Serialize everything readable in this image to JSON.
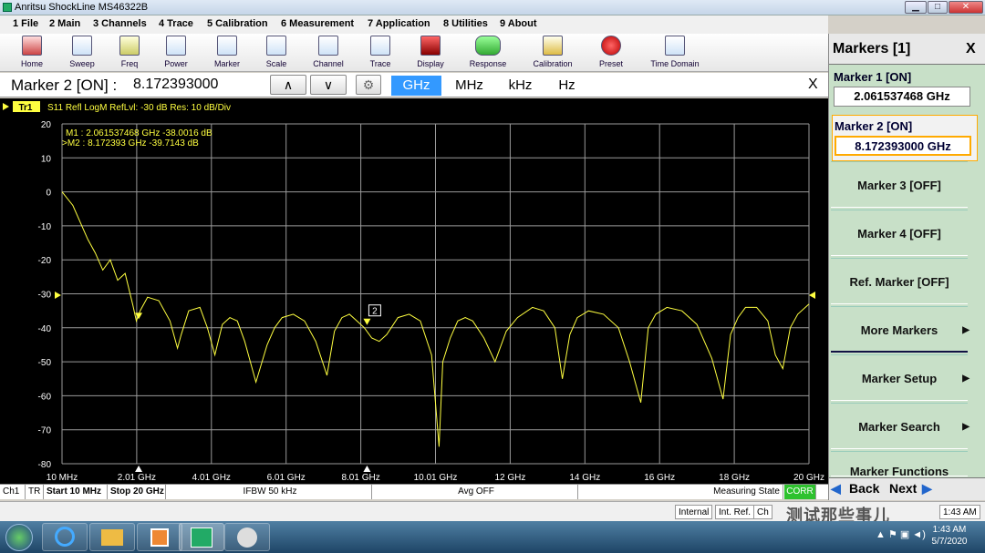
{
  "window": {
    "title": "Anritsu ShockLine MS46322B"
  },
  "menu": [
    "1 File",
    "2 Main",
    "3 Channels",
    "4 Trace",
    "5 Calibration",
    "6 Measurement",
    "7 Application",
    "8 Utilities",
    "9 About"
  ],
  "toolbar": [
    "Home",
    "Sweep",
    "Freq",
    "Power",
    "Marker",
    "Scale",
    "Channel",
    "Trace",
    "Display",
    "Response",
    "Calibration",
    "Preset",
    "Time Domain"
  ],
  "entry": {
    "label": "Marker 2 [ON]  :",
    "value": "8.172393000",
    "units": [
      "GHz",
      "MHz",
      "kHz",
      "Hz"
    ],
    "selected_unit": "GHz",
    "up": "∧",
    "down": "∨",
    "gear": "⚙",
    "close": "X"
  },
  "plot": {
    "trace_tag": "Tr1",
    "header": "S11 Refl LogM RefLvl: -30  dB Res: 10  dB/Div",
    "m1_readout": "M1 :  2.061537468 GHz  -38.0016  dB",
    "m2_readout": ">M2 :  8.172393 GHz  -39.7143  dB",
    "m2_flag": "2"
  },
  "chart_data": {
    "type": "line",
    "title": "",
    "xlabel": "",
    "ylabel": "",
    "xlim": [
      0.01,
      20
    ],
    "ylim": [
      -80,
      20
    ],
    "grid": true,
    "y_ticks": [
      "20",
      "10",
      "0",
      "-10",
      "-20",
      "-30",
      "-40",
      "-50",
      "-60",
      "-70",
      "-80"
    ],
    "x_ticks": [
      "10 MHz",
      "2.01 GHz",
      "4.01 GHz",
      "6.01 GHz",
      "8.01 GHz",
      "10.01 GHz",
      "12 GHz",
      "14 GHz",
      "16 GHz",
      "18 GHz",
      "20 GHz"
    ],
    "ref_level": -30,
    "series": [
      {
        "color": "#ffff40",
        "x": [
          0.01,
          0.3,
          0.5,
          0.7,
          0.9,
          1.1,
          1.3,
          1.5,
          1.7,
          1.9,
          2.0,
          2.1,
          2.3,
          2.6,
          2.9,
          3.1,
          3.2,
          3.4,
          3.7,
          3.9,
          4.1,
          4.3,
          4.5,
          4.7,
          4.9,
          5.2,
          5.5,
          5.7,
          5.9,
          6.2,
          6.5,
          6.8,
          7.1,
          7.3,
          7.5,
          7.7,
          7.9,
          8.1,
          8.3,
          8.5,
          8.7,
          9.0,
          9.3,
          9.6,
          9.9,
          10.1,
          10.2,
          10.4,
          10.6,
          10.8,
          11.0,
          11.3,
          11.6,
          11.9,
          12.2,
          12.6,
          12.9,
          13.2,
          13.4,
          13.6,
          13.8,
          14.1,
          14.5,
          14.9,
          15.2,
          15.5,
          15.7,
          15.9,
          16.2,
          16.6,
          17.0,
          17.4,
          17.7,
          17.9,
          18.1,
          18.3,
          18.6,
          18.9,
          19.1,
          19.3,
          19.5,
          19.7,
          20.0
        ],
        "y": [
          0,
          -4,
          -9,
          -14,
          -18,
          -23,
          -20,
          -26,
          -24,
          -33,
          -38,
          -35,
          -31,
          -32,
          -38,
          -46,
          -42,
          -35,
          -34,
          -40,
          -48,
          -39,
          -37,
          -38,
          -44,
          -56,
          -45,
          -40,
          -37,
          -36,
          -38,
          -44,
          -54,
          -41,
          -37,
          -36,
          -38,
          -40,
          -43,
          -44,
          -42,
          -37,
          -36,
          -38,
          -48,
          -75,
          -50,
          -43,
          -38,
          -37,
          -38,
          -43,
          -50,
          -41,
          -37,
          -34,
          -35,
          -40,
          -55,
          -42,
          -37,
          -35,
          -36,
          -40,
          -50,
          -62,
          -40,
          -36,
          -34,
          -35,
          -39,
          -49,
          -61,
          -42,
          -37,
          -34,
          -34,
          -38,
          -48,
          -52,
          -40,
          -36,
          -33
        ]
      }
    ],
    "markers": [
      {
        "name": "M1",
        "x": 2.061537468,
        "y": -38.0016
      },
      {
        "name": "M2",
        "x": 8.172393,
        "y": -39.7143
      }
    ]
  },
  "status": {
    "ch": "Ch1",
    "tr": "TR",
    "start": "Start 10 MHz",
    "stop": "Stop 20 GHz",
    "ifbw": "IFBW 50 kHz",
    "avg": "Avg OFF",
    "measuring": "Measuring State",
    "corr": "CORR",
    "internal": "Internal",
    "intref": "Int. Ref.",
    "ch2": "Ch",
    "time": "1:43 AM"
  },
  "panel": {
    "header": "Markers [1]",
    "close": "X",
    "m1_label": "Marker 1 [ON]",
    "m1_value": "2.061537468 GHz",
    "m2_label": "Marker 2 [ON]",
    "m2_value": "8.172393000 GHz",
    "buttons": [
      "Marker 3 [OFF]",
      "Marker 4 [OFF]",
      "Ref. Marker [OFF]",
      "More Markers",
      "Marker Setup",
      "Marker Search",
      "Marker Functions"
    ],
    "back": "Back",
    "next": "Next"
  },
  "taskbar": {
    "clock_time": "1:43 AM",
    "clock_date": "5/7/2020",
    "watermark": "测试那些事儿"
  }
}
